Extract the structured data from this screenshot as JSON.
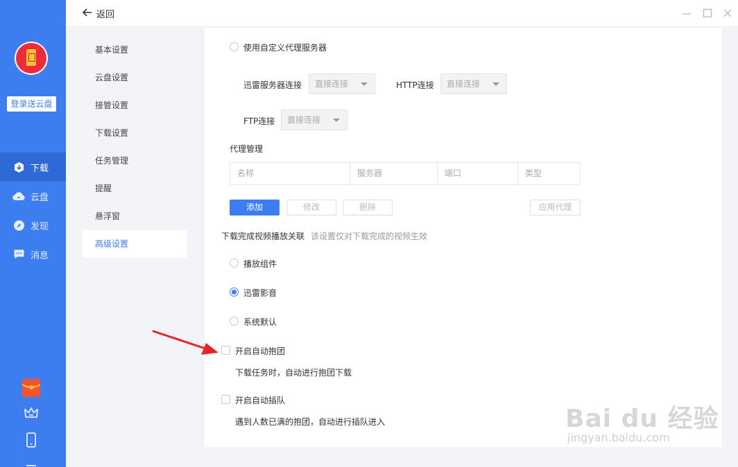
{
  "sidebar": {
    "login_label": "登录送云盘",
    "items": [
      {
        "label": "下载",
        "icon": "download-icon"
      },
      {
        "label": "云盘",
        "icon": "cloud-icon"
      },
      {
        "label": "发现",
        "icon": "compass-icon"
      },
      {
        "label": "消息",
        "icon": "message-icon"
      }
    ],
    "bottom_icons": [
      "red-envelope-icon",
      "crown-icon",
      "phone-icon",
      "menu-icon"
    ]
  },
  "titlebar": {
    "back_label": "返回",
    "controls": [
      "minimize-icon",
      "maximize-icon",
      "close-icon"
    ]
  },
  "settings_menu": [
    "基本设置",
    "云盘设置",
    "接管设置",
    "下载设置",
    "任务管理",
    "提醒",
    "悬浮窗",
    "高级设置"
  ],
  "settings_menu_active": "高级设置",
  "proxy": {
    "custom_proxy_label": "使用自定义代理服务器",
    "xunlei_label": "迅雷服务器连接",
    "xunlei_value": "直接连接",
    "http_label": "HTTP连接",
    "http_value": "直接连接",
    "ftp_label": "FTP连接",
    "ftp_value": "直接连接",
    "manage_title": "代理管理",
    "columns": [
      "名称",
      "服务器",
      "端口",
      "类型"
    ],
    "add_label": "添加",
    "edit_label": "修改",
    "delete_label": "删除",
    "apply_label": "应用代理"
  },
  "video": {
    "title": "下载完成视频播放关联",
    "hint": "该设置仅对下载完成的视频生效",
    "options": [
      "播放组件",
      "迅雷影音",
      "系统默认"
    ],
    "selected": "迅雷影音"
  },
  "group": {
    "auto_group_label": "开启自动抱团",
    "auto_group_desc": "下载任务时，自动进行抱团下载",
    "auto_join_label": "开启自动插队",
    "auto_join_desc": "遇到人数已满的抱团，自动进行插队进入"
  },
  "watermark": {
    "main": "Bai du 经验",
    "sub": "jingyan.baidu.com"
  },
  "colors": {
    "accent": "#3c7ef0",
    "annotation_arrow": "#e8232a"
  }
}
